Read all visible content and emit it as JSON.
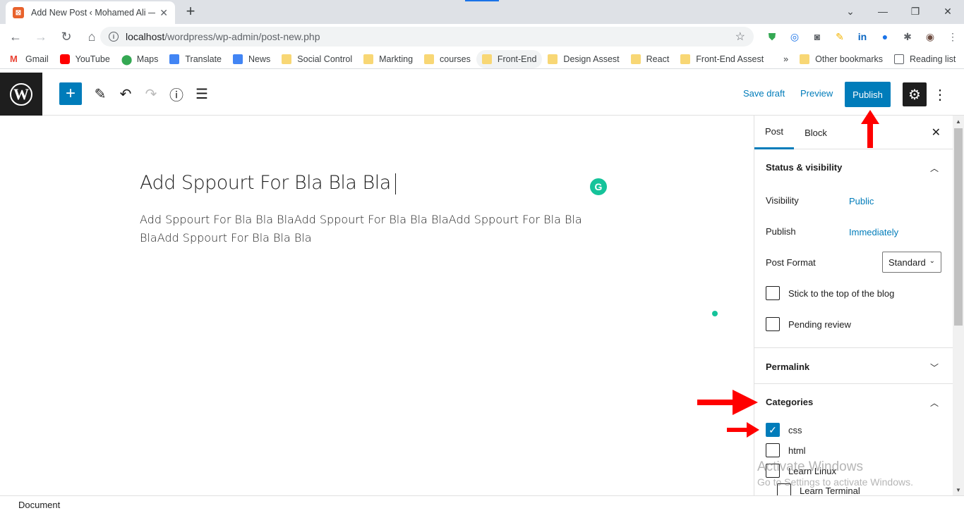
{
  "browser": {
    "tab_title": "Add New Post ‹ Mohamed Ali —",
    "url_host": "localhost",
    "url_path": "/wordpress/wp-admin/post-new.php",
    "bookmarks": [
      "Gmail",
      "YouTube",
      "Maps",
      "Translate",
      "News",
      "Social Control",
      "Markting",
      "courses",
      "Front-End",
      "Design Assest",
      "React",
      "Front-End Assest"
    ],
    "more_bookmarks": "»",
    "other_bookmarks": "Other bookmarks",
    "reading_list": "Reading list"
  },
  "wp_toolbar": {
    "save_draft": "Save draft",
    "preview": "Preview",
    "publish": "Publish"
  },
  "editor": {
    "title": "Add Sppourt For Bla Bla Bla",
    "body": "Add Sppourt For Bla Bla BlaAdd Sppourt For Bla Bla BlaAdd Sppourt For Bla Bla BlaAdd Sppourt For Bla Bla Bla",
    "grammarly_letter": "G"
  },
  "sidebar": {
    "tab_post": "Post",
    "tab_block": "Block",
    "status_visibility": "Status & visibility",
    "visibility_label": "Visibility",
    "visibility_value": "Public",
    "publish_label": "Publish",
    "publish_value": "Immediately",
    "post_format_label": "Post Format",
    "post_format_value": "Standard",
    "stick_top": "Stick to the top of the blog",
    "pending_review": "Pending review",
    "permalink": "Permalink",
    "categories": "Categories",
    "category_items": [
      "css",
      "html",
      "Learn Linux",
      "Learn Terminal"
    ]
  },
  "footer": {
    "breadcrumb": "Document"
  },
  "watermark": {
    "line1": "Activate Windows",
    "line2": "Go to Settings to activate Windows."
  },
  "colors": {
    "wp_blue": "#007cba",
    "annotation_red": "#ff0000"
  }
}
